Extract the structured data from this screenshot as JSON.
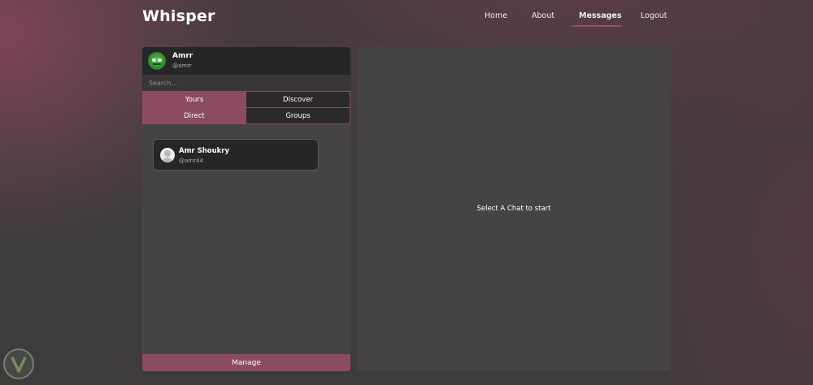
{
  "app": {
    "brand": "Whisper"
  },
  "nav": {
    "items": [
      {
        "label": "Home"
      },
      {
        "label": "About"
      },
      {
        "label": "Messages"
      },
      {
        "label": "Logout"
      }
    ],
    "active": "Messages"
  },
  "sidebar": {
    "profile": {
      "name": "Amrr",
      "handle": "@amrr"
    },
    "search": {
      "placeholder": "Search...",
      "value": ""
    },
    "tabs": [
      {
        "label": "Yours",
        "selected": true
      },
      {
        "label": "Discover",
        "selected": false
      },
      {
        "label": "Direct",
        "selected": true
      },
      {
        "label": "Groups",
        "selected": false
      }
    ],
    "contacts": [
      {
        "name": "Amr Shoukry",
        "handle": "@amr44"
      }
    ],
    "manage_label": "Manage"
  },
  "chat": {
    "empty_message": "Select A Chat to start"
  },
  "colors": {
    "accent": "#8c4b60",
    "panel": "#454344",
    "dark": "#262626",
    "background": "#3d3b3c"
  }
}
